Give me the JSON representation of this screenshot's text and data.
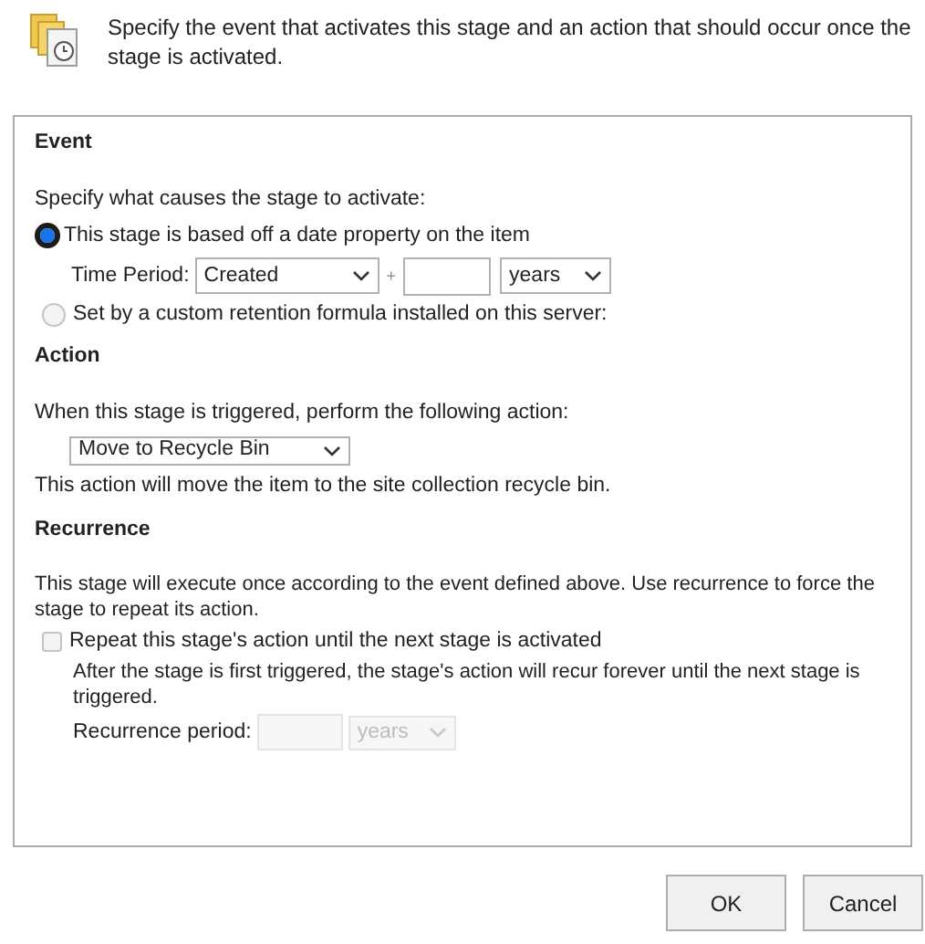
{
  "header": {
    "description": "Specify the event that activates this stage and an action that should occur once the stage is activated."
  },
  "event": {
    "heading": "Event",
    "prompt": "Specify what causes the stage to activate:",
    "options": [
      {
        "label": "This stage is based off a date property on the item",
        "selected": true
      },
      {
        "label": "Set by a custom retention formula installed on this server:",
        "selected": false
      }
    ],
    "time_period": {
      "label": "Time Period:",
      "property": "Created",
      "plus": "+",
      "unit": "years"
    }
  },
  "action": {
    "heading": "Action",
    "prompt": "When this stage is triggered, perform the following action:",
    "selected_action": "Move to Recycle Bin",
    "note": "This action will move the item to the site collection recycle bin."
  },
  "recurrence": {
    "heading": "Recurrence",
    "description": "This stage will execute once according to the event defined above. Use recurrence to force the stage to repeat its action.",
    "checkbox": {
      "label": "Repeat this stage's action until the next stage is activated",
      "checked": false
    },
    "note": "After the stage is first triggered, the stage's action will recur forever until the next stage is triggered.",
    "period_label": "Recurrence period:",
    "period_unit": "years",
    "disabled": true
  },
  "buttons": [
    "OK",
    "Cancel"
  ]
}
